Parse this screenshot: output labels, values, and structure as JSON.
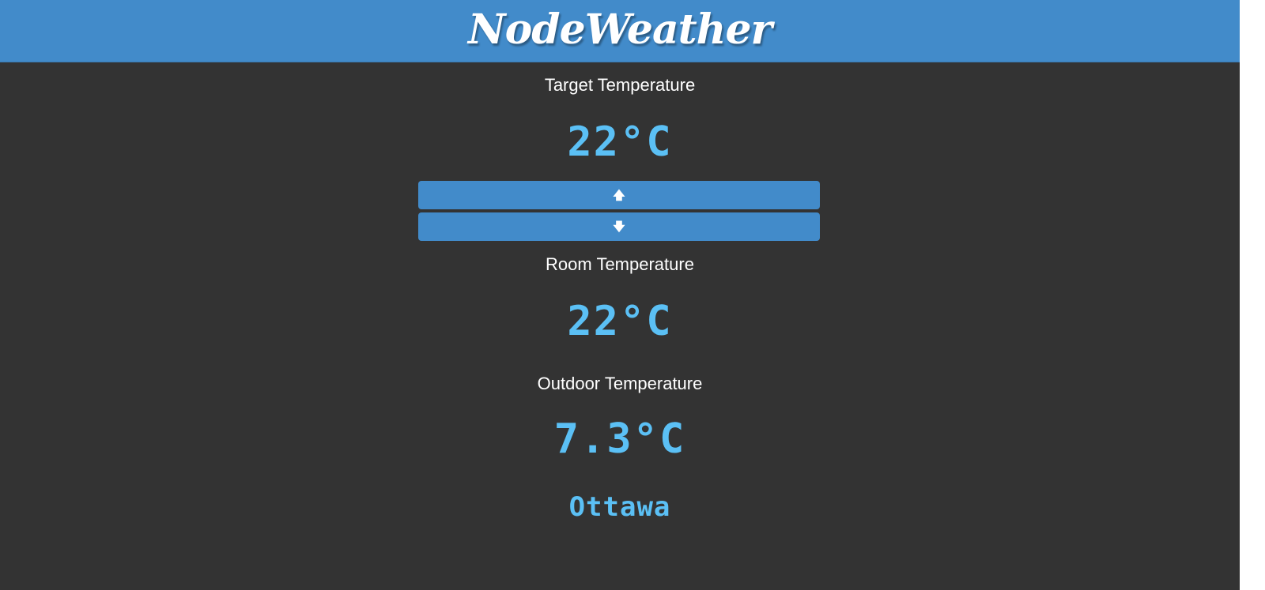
{
  "header": {
    "title": "NodeWeather",
    "background_color": "#428bca"
  },
  "target": {
    "label": "Target Temperature",
    "value": "22°C",
    "up_label": "🡅",
    "down_label": "🡇",
    "up_icon": "arrow-up-icon",
    "down_icon": "arrow-down-icon"
  },
  "room": {
    "label": "Room Temperature",
    "value": "22°C"
  },
  "outdoor": {
    "label": "Outdoor Temperature",
    "value": "7.3°C",
    "city": "Ottawa"
  },
  "colors": {
    "background": "#333333",
    "accent": "#428bca",
    "value_text": "#5bc0f5",
    "label_text": "#ffffff"
  }
}
